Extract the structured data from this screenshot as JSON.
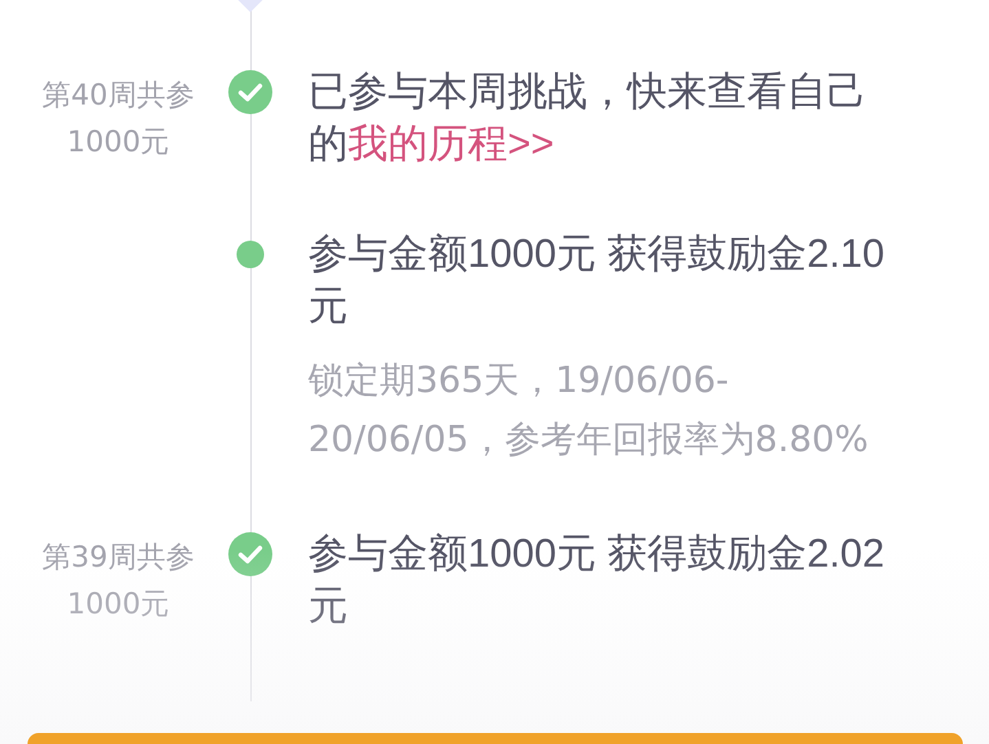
{
  "entries": [
    {
      "kind": "check",
      "label": "第40周共参1000元",
      "text": "已参与本周挑战，快来查看自己的",
      "link": "我的历程>>"
    },
    {
      "kind": "dot",
      "text": "参与金额1000元 获得鼓励金2.10元",
      "detail": "锁定期365天，19/06/06-20/06/05，参考年回报率为8.80%"
    },
    {
      "kind": "check",
      "label": "第39周共参1000元",
      "text": "参与金额1000元 获得鼓励金2.02元"
    }
  ]
}
